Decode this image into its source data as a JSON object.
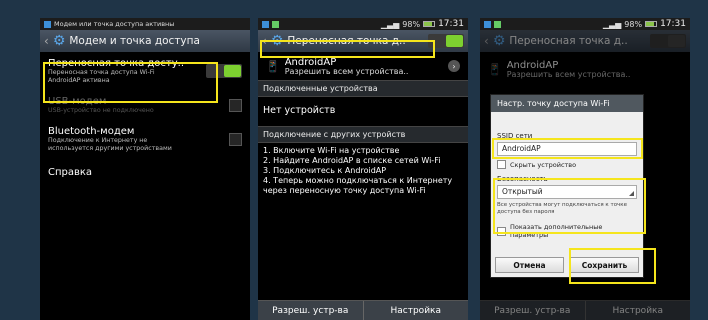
{
  "phone1": {
    "status_text": "Модем или точка доступа активны",
    "title": "Модем и точка доступа",
    "items": [
      {
        "title": "Переносная точка досту..",
        "subtitle": "Переносная точка доступа Wi-Fi AndroidAP активна"
      },
      {
        "title": "USB-модем",
        "subtitle": "USB-устройство не подключено"
      },
      {
        "title": "Bluetooth-модем",
        "subtitle": "Подключение к Интернету не используется другими устройствами"
      },
      {
        "title": "Справка"
      }
    ]
  },
  "phone2": {
    "status_battery": "98%",
    "status_time": "17:31",
    "title": "Переносная точка д..",
    "network": {
      "name": "AndroidAP",
      "subtitle": "Разрешить всем устройства.."
    },
    "section_connected": "Подключенные устройства",
    "no_devices": "Нет устройств",
    "section_connect_other": "Подключение с других устройств",
    "steps": [
      "1. Включите Wi-Fi на устройстве",
      "2. Найдите AndroidAP в списке сетей Wi-Fi",
      "3. Подключитесь к AndroidAP",
      "4. Теперь можно подключаться к Интернету через переносную точку доступа Wi-Fi"
    ],
    "bottom_left": "Разреш. устр-ва",
    "bottom_right": "Настройка"
  },
  "phone3": {
    "status_battery": "98%",
    "status_time": "17:31",
    "title": "Переносная точка д..",
    "network_name": "AndroidAP",
    "network_subtitle": "Разрешить всем устройства..",
    "dialog": {
      "title": "Настр. точку доступа Wi-Fi",
      "ssid_label": "SSID сети",
      "ssid_value": "AndroidAP",
      "hide_device": "Скрыть устройство",
      "security_label": "Безопасность",
      "security_value": "Открытый",
      "security_note": "Все устройства могут подключаться к точке доступа без пароля",
      "show_advanced": "Показать дополнительные параметры",
      "cancel": "Отмена",
      "save": "Сохранить"
    },
    "bottom_left": "Разреш. устр-ва",
    "bottom_right": "Настройка"
  },
  "colors": {
    "highlight": "#f5e51c",
    "toggle_on": "#7dd030",
    "link": "#39a0e0"
  }
}
